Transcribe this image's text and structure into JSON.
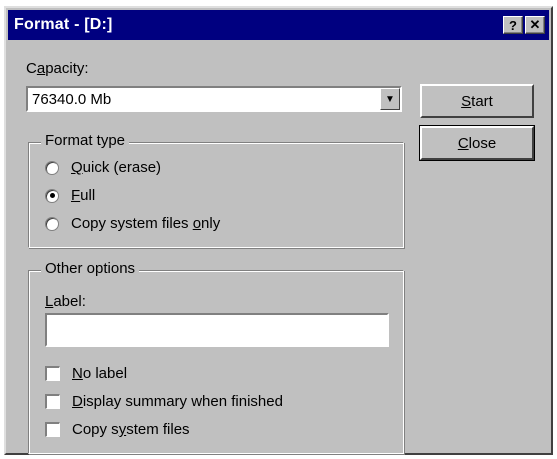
{
  "window": {
    "title": "Format -  [D:]",
    "help_glyph": "?",
    "close_glyph": "✕"
  },
  "capacity": {
    "label_mnemonic": "a",
    "label_pre": "C",
    "label_post": "pacity:",
    "selected_value": "76340.0 Mb",
    "arrow_glyph": "▼"
  },
  "buttons": {
    "start_mnemonic": "S",
    "start_rest": "tart",
    "close_mnemonic": "C",
    "close_rest": "lose"
  },
  "format_type": {
    "legend": "Format type",
    "options": [
      {
        "mnemonic": "Q",
        "pre": "",
        "post": "uick (erase)",
        "selected": false
      },
      {
        "mnemonic": "F",
        "pre": "",
        "post": "ull",
        "selected": true
      },
      {
        "mnemonic": "o",
        "pre": "Copy system files ",
        "post": "nly",
        "selected": false
      }
    ]
  },
  "other_options": {
    "legend": "Other options",
    "label_caption_mnemonic": "L",
    "label_caption_rest": "abel:",
    "label_value": "",
    "checkboxes": [
      {
        "mnemonic": "N",
        "pre": "",
        "post": "o label",
        "checked": false
      },
      {
        "mnemonic": "D",
        "pre": "",
        "post": "isplay summary when finished",
        "checked": false
      },
      {
        "mnemonic": "y",
        "pre": "Copy s",
        "post": "stem files",
        "checked": false
      }
    ]
  }
}
